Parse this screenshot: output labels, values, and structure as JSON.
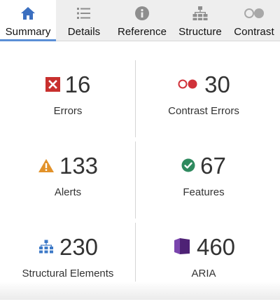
{
  "tabs": [
    {
      "label": "Summary",
      "icon": "home-icon",
      "active": true
    },
    {
      "label": "Details",
      "icon": "list-icon",
      "active": false
    },
    {
      "label": "Reference",
      "icon": "info-icon",
      "active": false
    },
    {
      "label": "Structure",
      "icon": "hierarchy-icon",
      "active": false
    },
    {
      "label": "Contrast",
      "icon": "contrast-icon",
      "active": false
    }
  ],
  "summary": {
    "errors": {
      "count": "16",
      "label": "Errors",
      "icon": "error-x-icon",
      "color": "#c8302e"
    },
    "contrast_errors": {
      "count": "30",
      "label": "Contrast Errors",
      "icon": "contrast-error-icon",
      "color": "#d0323a"
    },
    "alerts": {
      "count": "133",
      "label": "Alerts",
      "icon": "alert-triangle-icon",
      "color": "#e2922a"
    },
    "features": {
      "count": "67",
      "label": "Features",
      "icon": "feature-check-icon",
      "color": "#2f8a5f"
    },
    "structural": {
      "count": "230",
      "label": "Structural Elements",
      "icon": "structure-icon",
      "color": "#3c79c7"
    },
    "aria": {
      "count": "460",
      "label": "ARIA",
      "icon": "aria-cube-icon",
      "color": "#5e2d8a"
    }
  },
  "colors": {
    "active_tab_indicator": "#5b8fd6",
    "home_icon": "#3b6fc0",
    "inactive_icon": "#8e8e8e"
  }
}
